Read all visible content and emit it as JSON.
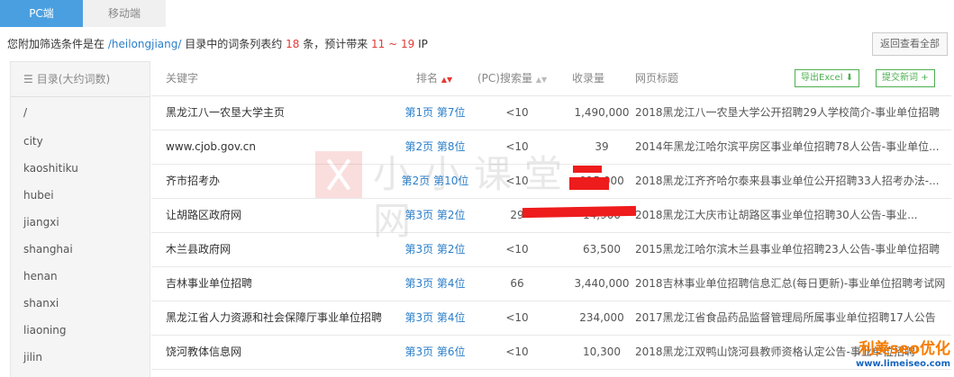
{
  "tabs": [
    {
      "label": "PC端",
      "active": true
    },
    {
      "label": "移动端",
      "active": false
    }
  ],
  "filter": {
    "prefix": "您附加筛选条件是在",
    "directory": "/heilongjiang/",
    "mid1": "目录中的词条列表约",
    "count": "18",
    "mid2": "条，预计带来",
    "ip_low": "11",
    "tilde": "~",
    "ip_high": "19",
    "suffix": "IP"
  },
  "reset_button": "返回查看全部",
  "sidebar": {
    "header": "目录(大约词数)",
    "header_icon": "list-icon",
    "items": [
      "/",
      "city",
      "kaoshitiku",
      "hubei",
      "jiangxi",
      "shanghai",
      "henan",
      "shanxi",
      "liaoning",
      "jilin"
    ]
  },
  "table": {
    "columns": {
      "keyword": "关键字",
      "rank": "排名",
      "search": "(PC)搜索量",
      "indexed": "收录量",
      "title": "网页标题"
    },
    "export_button": "导出Excel",
    "export_icon": "download-icon",
    "submit_button": "提交新词",
    "submit_icon": "plus-icon",
    "rows": [
      {
        "keyword": "黑龙江八一农垦大学主页",
        "rank": "第1页 第7位",
        "search": "<10",
        "indexed": "1,490,000",
        "title": "2018黑龙江八一农垦大学公开招聘29人学校简介-事业单位招聘"
      },
      {
        "keyword": "www.cjob.gov.cn",
        "rank": "第2页 第8位",
        "search": "<10",
        "indexed": "39",
        "title": "2014年黑龙江哈尔滨平房区事业单位招聘78人公告-事业单位..."
      },
      {
        "keyword": "齐市招考办",
        "rank": "第2页 第10位",
        "search": "<10",
        "indexed": "915,000",
        "title": "2018黑龙江齐齐哈尔泰来县事业单位公开招聘33人招考办法-..."
      },
      {
        "keyword": "让胡路区政府网",
        "rank": "第3页 第2位",
        "search": "29",
        "indexed": "14,900",
        "title": "2018黑龙江大庆市让胡路区事业单位招聘30人公告-事业..."
      },
      {
        "keyword": "木兰县政府网",
        "rank": "第3页 第2位",
        "search": "<10",
        "indexed": "63,500",
        "title": "2015黑龙江哈尔滨木兰县事业单位招聘23人公告-事业单位招聘"
      },
      {
        "keyword": "吉林事业单位招聘",
        "rank": "第3页 第4位",
        "search": "66",
        "indexed": "3,440,000",
        "title": "2018吉林事业单位招聘信息汇总(每日更新)-事业单位招聘考试网"
      },
      {
        "keyword": "黑龙江省人力资源和社会保障厅事业单位招聘",
        "rank": "第3页 第4位",
        "search": "<10",
        "indexed": "234,000",
        "title": "2017黑龙江省食品药品监督管理局所属事业单位招聘17人公告"
      },
      {
        "keyword": "饶河教体信息网",
        "rank": "第3页 第6位",
        "search": "<10",
        "indexed": "10,300",
        "title": "2018黑龙江双鸭山饶河县教师资格认定公告-事业单位招聘"
      }
    ]
  },
  "watermark": "小小课堂网",
  "brand": {
    "title": "利美seo优化",
    "url": "www.limeiseo.com"
  },
  "colors": {
    "accent": "#4a9fe0",
    "link": "#2a7ec9",
    "highlight": "#e53935",
    "button_green": "#4caf50",
    "redaction": "#ee1c1c"
  }
}
